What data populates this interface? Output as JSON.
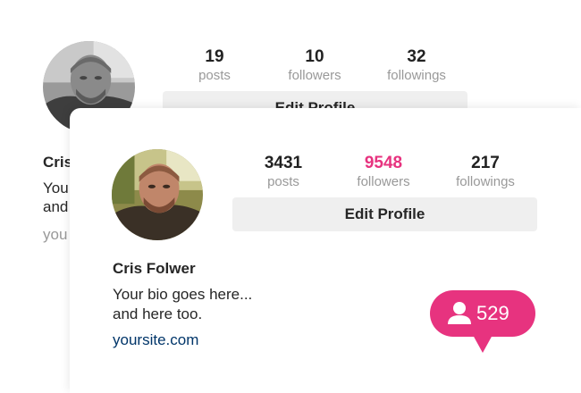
{
  "colors": {
    "accent": "#e7337f",
    "text_dark": "#262626",
    "text_muted": "#999999",
    "link": "#003569",
    "button_bg": "#efefef"
  },
  "back_profile": {
    "stats": {
      "posts": {
        "count": "19",
        "label": "posts"
      },
      "followers": {
        "count": "10",
        "label": "followers"
      },
      "followings": {
        "count": "32",
        "label": "followings"
      }
    },
    "edit_label": "Edit Profile",
    "name": "Cris",
    "bio_line1": "You",
    "bio_line2": "and",
    "website": "you"
  },
  "front_profile": {
    "stats": {
      "posts": {
        "count": "3431",
        "label": "posts"
      },
      "followers": {
        "count": "9548",
        "label": "followers"
      },
      "followings": {
        "count": "217",
        "label": "followings"
      }
    },
    "edit_label": "Edit Profile",
    "name": "Cris Folwer",
    "bio_line1": "Your bio goes here...",
    "bio_line2": "and here too.",
    "website": "yoursite.com"
  },
  "notification": {
    "icon": "user-icon",
    "count": "529"
  }
}
